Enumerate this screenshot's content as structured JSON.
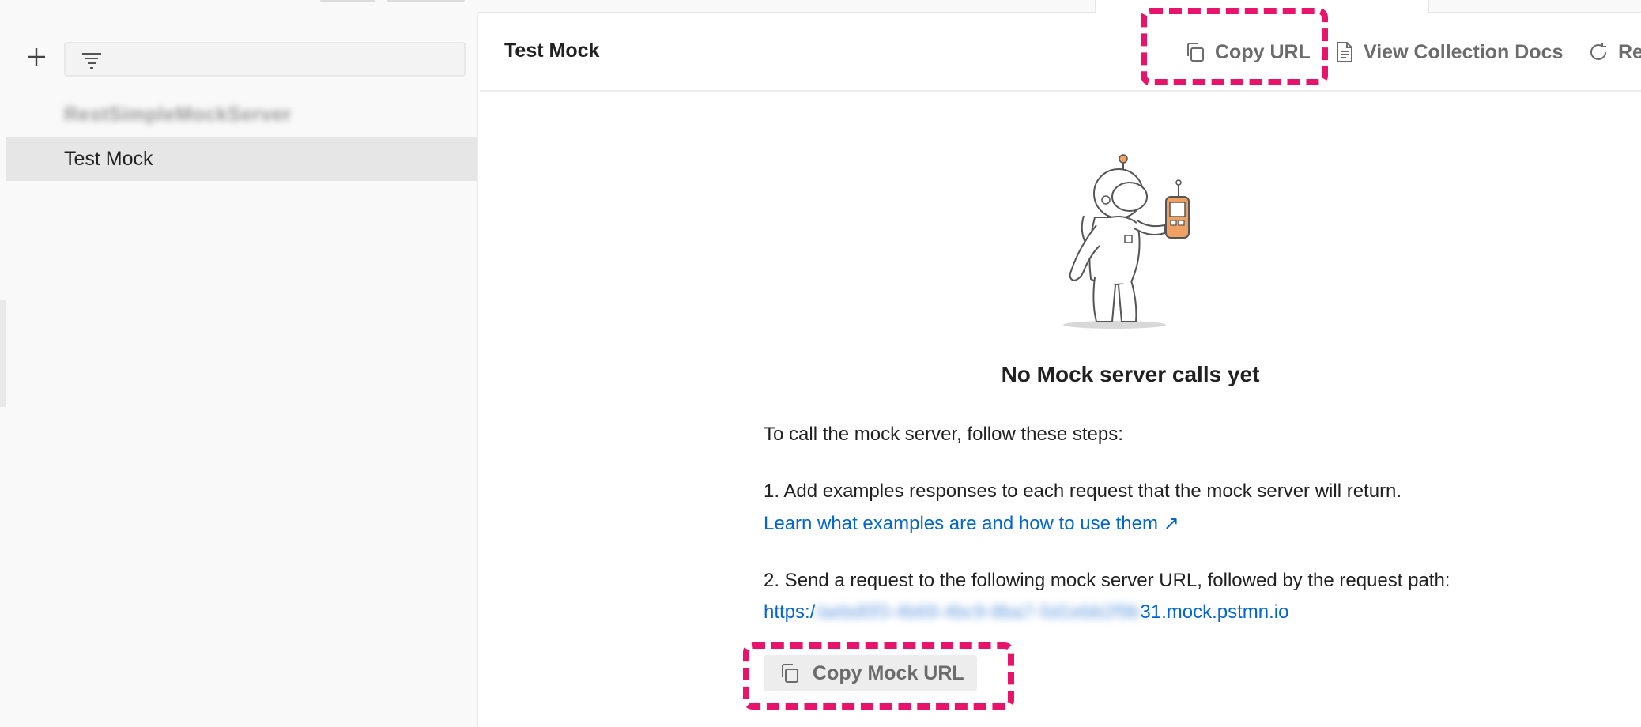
{
  "sidebar": {
    "add_icon": "plus-icon",
    "filter_icon": "filter-lines-icon",
    "filter_placeholder": "",
    "items": [
      {
        "label": "RestSimpleMockServer",
        "blurred": true
      },
      {
        "label": "Test Mock",
        "selected": true
      }
    ]
  },
  "header": {
    "title": "Test Mock",
    "copy_url_label": "Copy URL",
    "view_docs_label": "View Collection Docs",
    "refresh_label": "Re"
  },
  "empty_state": {
    "title": "No Mock server calls yet",
    "intro": "To call the mock server, follow these steps:",
    "step1": "1. Add examples responses to each request that the mock server will return.",
    "step1_link": "Learn what examples are and how to use them ↗",
    "step2": "2. Send a request to the following mock server URL, followed by the request path:",
    "url_prefix": "https:/",
    "url_hidden": "/aebd0f3-4b69-4bc9-8ba7-5d1ebb2f9b",
    "url_suffix": "31.mock.pstmn.io",
    "copy_mock_label": "Copy Mock URL"
  },
  "colors": {
    "accent_link": "#0265d2",
    "highlight": "#e8146b",
    "selected_row": "#e6e6e6",
    "astronaut_phone": "#f0a060"
  }
}
